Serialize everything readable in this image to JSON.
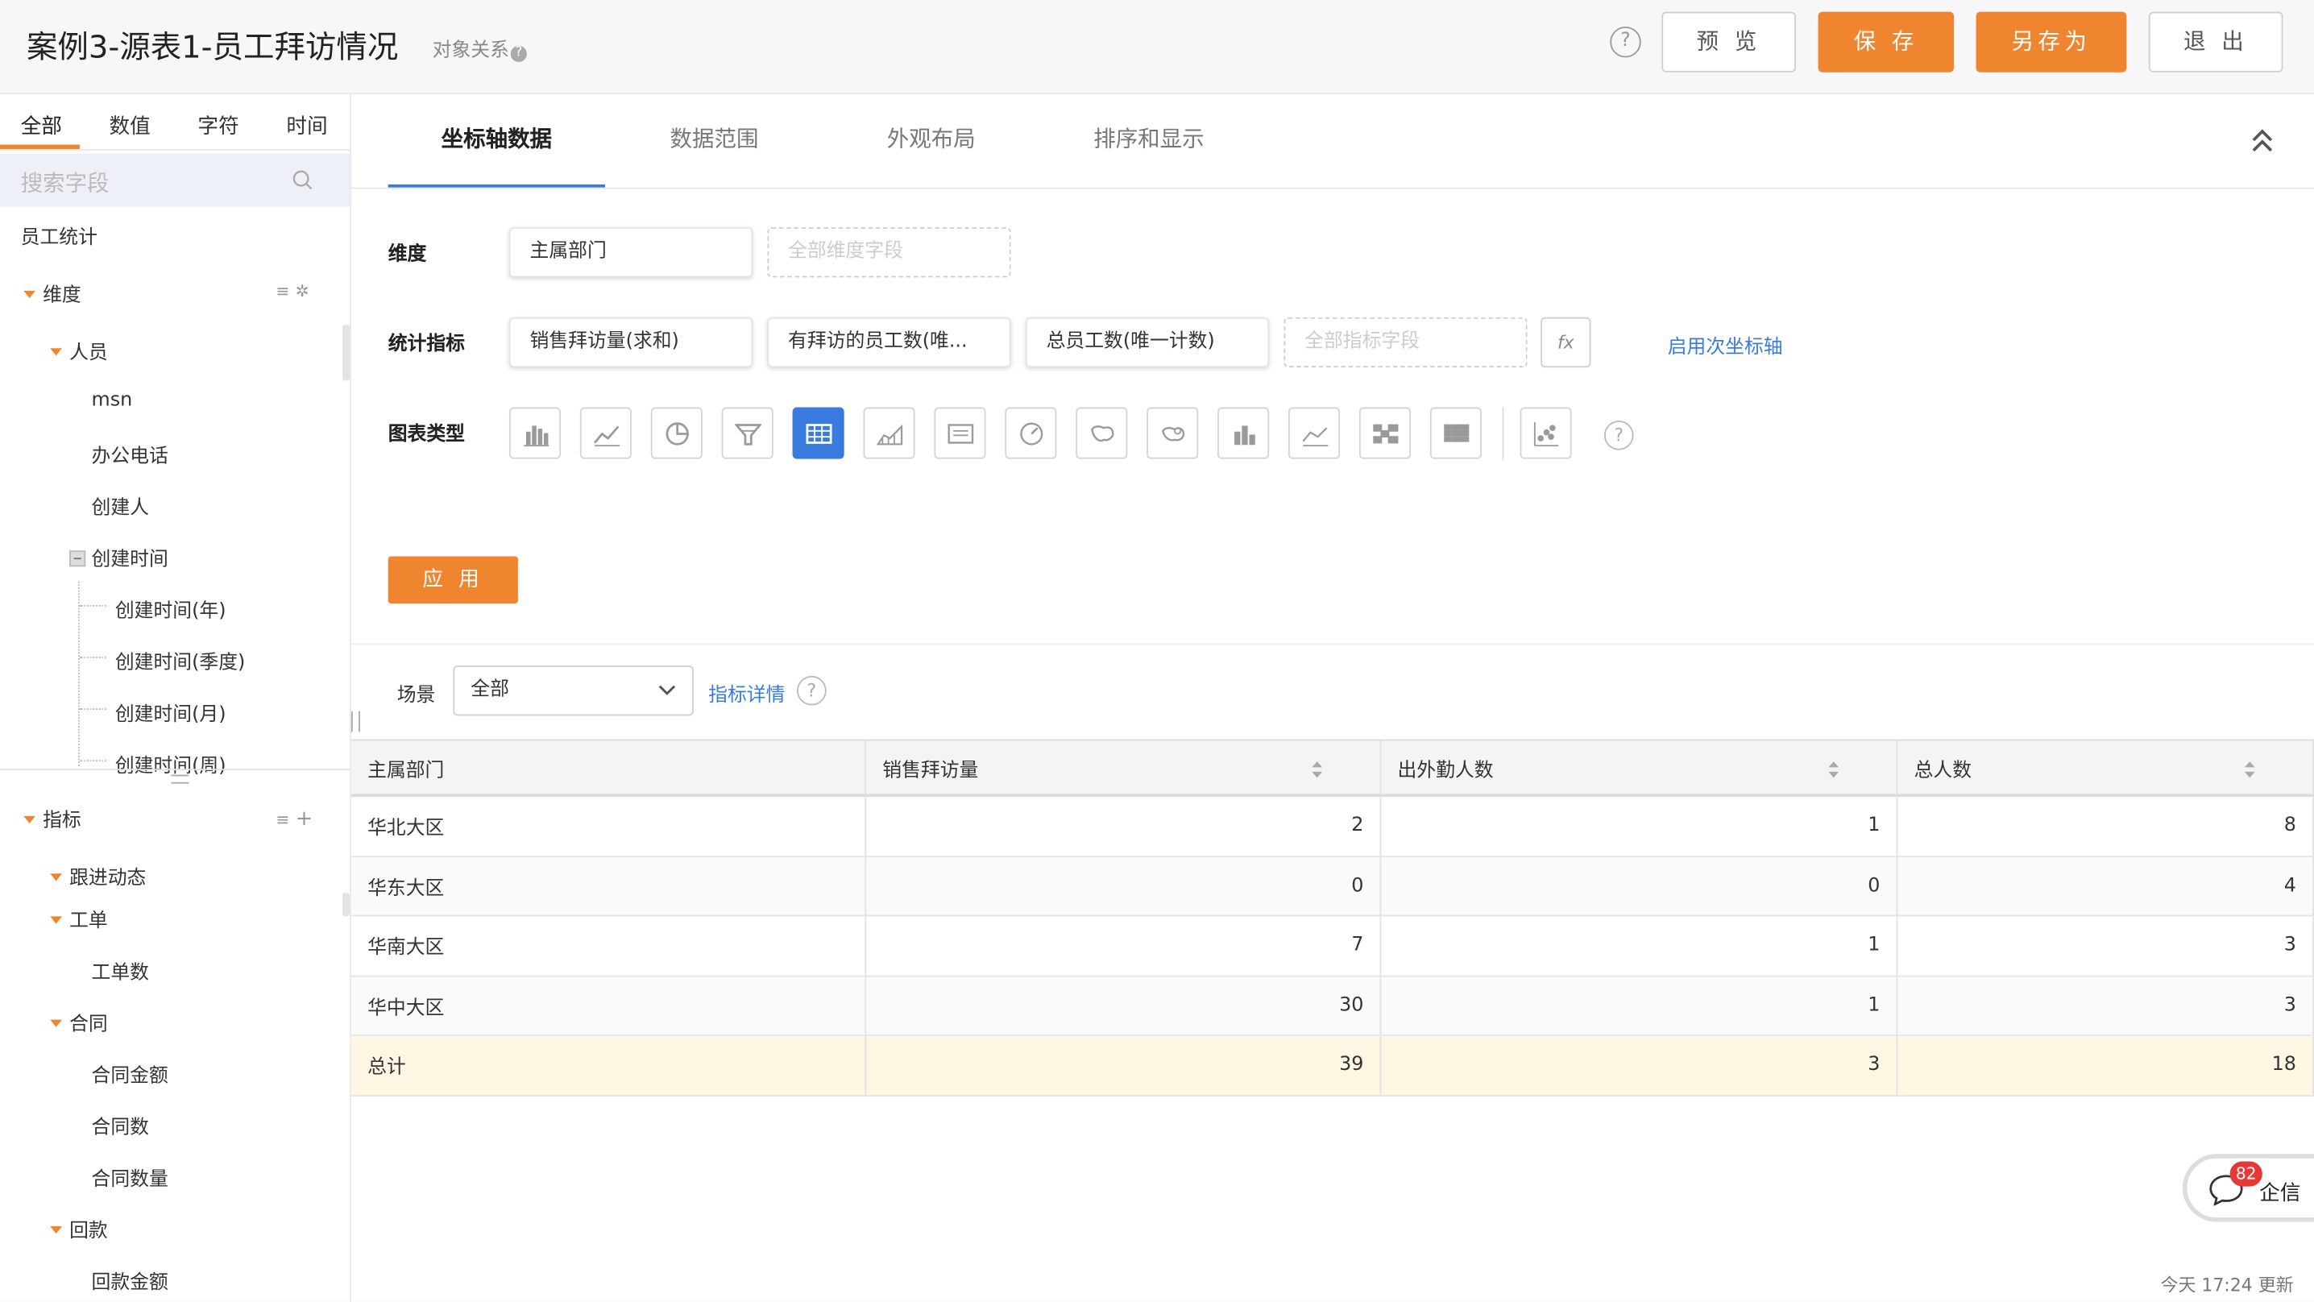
{
  "header": {
    "title": "案例3-源表1-员工拜访情况",
    "object_relation": "对象关系",
    "help_icon": "question-icon",
    "buttons": {
      "preview": "预 览",
      "save": "保 存",
      "save_as": "另存为",
      "exit": "退 出"
    },
    "accent_color": "#f0852f"
  },
  "sidebar": {
    "tabs": [
      "全部",
      "数值",
      "字符",
      "时间"
    ],
    "active_tab": "全部",
    "search_placeholder": "搜索字段",
    "root": "员工统计",
    "dimension_group": "维度",
    "people_group": "人员",
    "people_items": [
      "msn",
      "办公电话",
      "创建人"
    ],
    "created_time": "创建时间",
    "created_time_children": [
      "创建时间(年)",
      "创建时间(季度)",
      "创建时间(月)",
      "创建时间(周)"
    ],
    "metric_group": "指标",
    "follow_up": "跟进动态",
    "work_order": "工单",
    "work_order_items": [
      "工单数"
    ],
    "contract": "合同",
    "contract_items": [
      "合同金额",
      "合同数",
      "合同数量"
    ],
    "payment": "回款",
    "payment_items": [
      "回款金额"
    ]
  },
  "main": {
    "tabs": [
      "坐标轴数据",
      "数据范围",
      "外观布局",
      "排序和显示"
    ],
    "active_tab": "坐标轴数据",
    "dimension_label": "维度",
    "dimension_field": "主属部门",
    "dimension_placeholder": "全部维度字段",
    "metric_label": "统计指标",
    "metric_fields": [
      "销售拜访量(求和)",
      "有拜访的员工数(唯...",
      "总员工数(唯一计数)"
    ],
    "metric_placeholder": "全部指标字段",
    "fx_label": "fx",
    "secondary_axis_link": "启用次坐标轴",
    "chart_type_label": "图表类型",
    "chart_types": [
      "bar-chart-icon",
      "line-chart-icon",
      "pie-chart-icon",
      "funnel-chart-icon",
      "table-chart-icon",
      "area-chart-icon",
      "text-card-icon",
      "gauge-chart-icon",
      "map-chart-icon",
      "geo-map-icon",
      "stacked-bar-icon",
      "dual-line-icon",
      "heatmap-icon",
      "pivot-table-icon",
      "scatter-chart-icon"
    ],
    "active_chart_type": "table-chart-icon",
    "apply_label": "应 用",
    "scene_label": "场景",
    "scene_value": "全部",
    "metric_detail_link": "指标详情"
  },
  "table": {
    "columns": [
      "主属部门",
      "销售拜访量",
      "出外勤人数",
      "总人数"
    ],
    "rows": [
      [
        "华北大区",
        "2",
        "1",
        "8"
      ],
      [
        "华东大区",
        "0",
        "0",
        "4"
      ],
      [
        "华南大区",
        "7",
        "1",
        "3"
      ],
      [
        "华中大区",
        "30",
        "1",
        "3"
      ]
    ],
    "total": [
      "总计",
      "39",
      "3",
      "18"
    ]
  },
  "widget": {
    "badge_count": "82",
    "label": "企信",
    "updated_text": "今天 17:24 更新"
  }
}
